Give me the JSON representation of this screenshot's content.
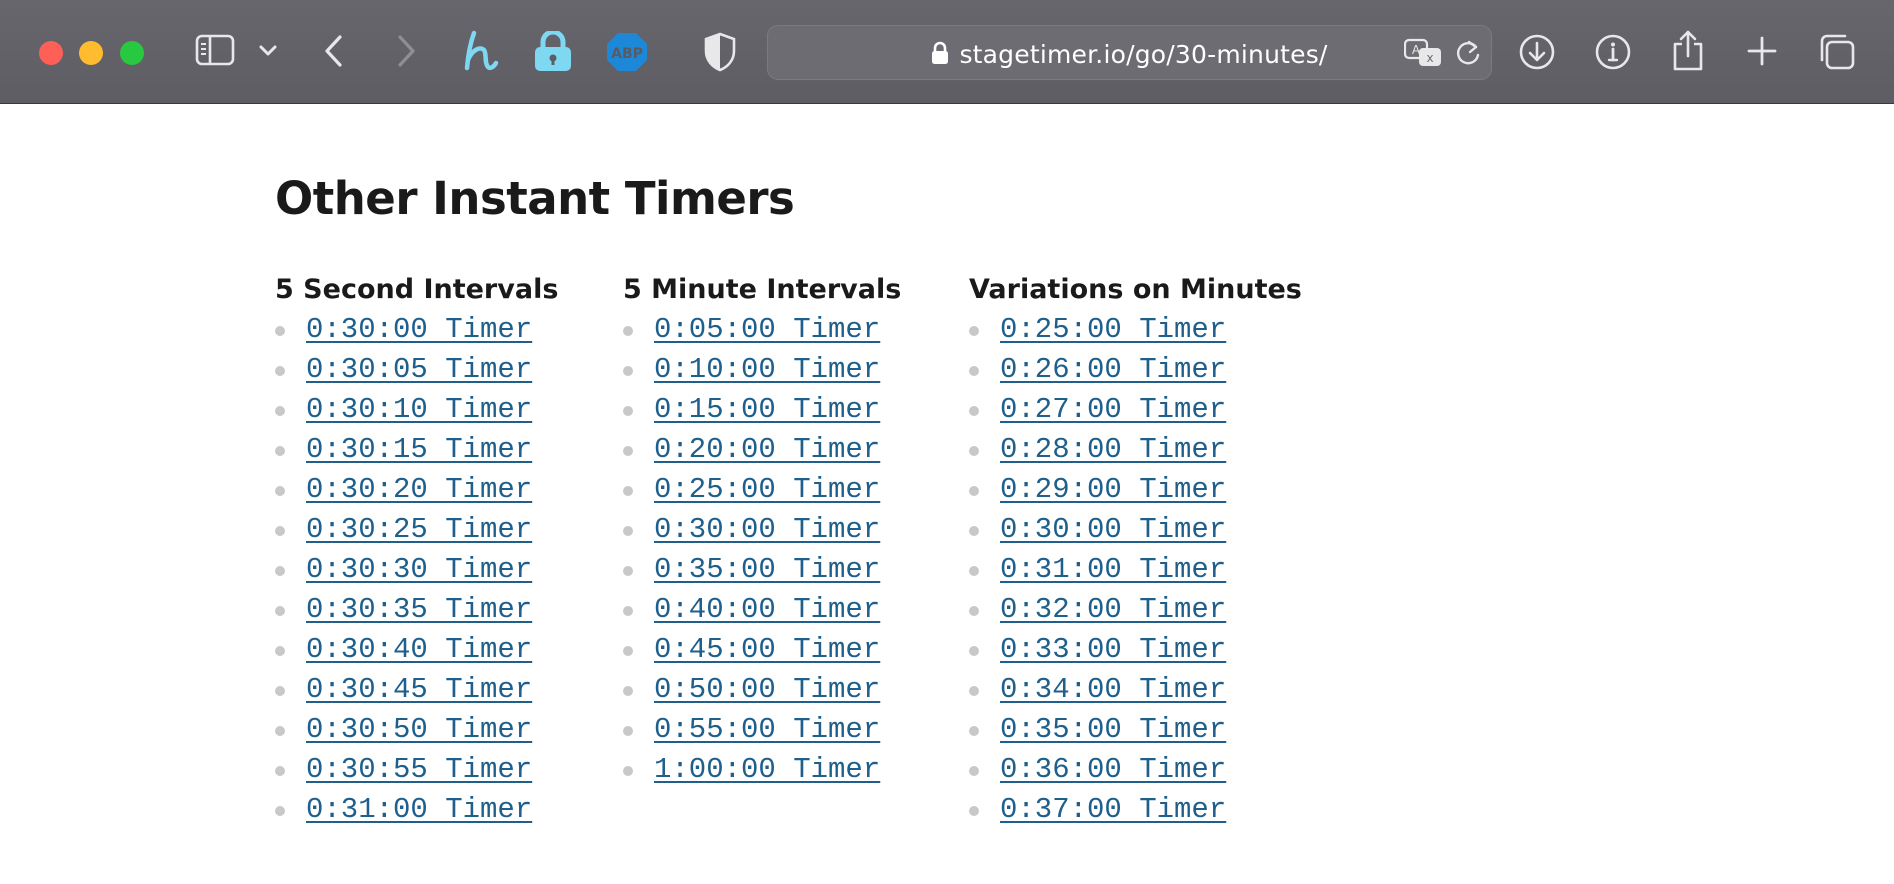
{
  "browser": {
    "url": "stagetimer.io/go/30-minutes/",
    "icons": {
      "sidebar": "sidebar-icon",
      "tab_overview_chevron": "chevron-down-icon",
      "back": "chevron-left-icon",
      "forward": "chevron-right-icon",
      "honey_extension": "honey-h-icon",
      "password_extension": "lock-icon",
      "adblock_extension": "abp-icon",
      "privacy_shield": "shield-icon",
      "translate": "translate-icon",
      "reload": "reload-icon",
      "downloads": "download-icon",
      "info": "info-icon",
      "share": "share-icon",
      "new_tab": "plus-icon",
      "tab_overview": "tabs-icon"
    },
    "adblock_label": "ABP"
  },
  "page": {
    "title": "Other Instant Timers",
    "columns": [
      {
        "heading": "5 Second Intervals",
        "items": [
          "0:30:00 Timer",
          "0:30:05 Timer",
          "0:30:10 Timer",
          "0:30:15 Timer",
          "0:30:20 Timer",
          "0:30:25 Timer",
          "0:30:30 Timer",
          "0:30:35 Timer",
          "0:30:40 Timer",
          "0:30:45 Timer",
          "0:30:50 Timer",
          "0:30:55 Timer",
          "0:31:00 Timer"
        ]
      },
      {
        "heading": "5 Minute Intervals",
        "items": [
          "0:05:00 Timer",
          "0:10:00 Timer",
          "0:15:00 Timer",
          "0:20:00 Timer",
          "0:25:00 Timer",
          "0:30:00 Timer",
          "0:35:00 Timer",
          "0:40:00 Timer",
          "0:45:00 Timer",
          "0:50:00 Timer",
          "0:55:00 Timer",
          "1:00:00 Timer"
        ]
      },
      {
        "heading": "Variations on Minutes",
        "items": [
          "0:25:00 Timer",
          "0:26:00 Timer",
          "0:27:00 Timer",
          "0:28:00 Timer",
          "0:29:00 Timer",
          "0:30:00 Timer",
          "0:31:00 Timer",
          "0:32:00 Timer",
          "0:33:00 Timer",
          "0:34:00 Timer",
          "0:35:00 Timer",
          "0:36:00 Timer",
          "0:37:00 Timer"
        ]
      }
    ]
  },
  "colors": {
    "link": "#1f5f8c",
    "heading": "#1a1a1a",
    "toolbar": "#626268"
  }
}
